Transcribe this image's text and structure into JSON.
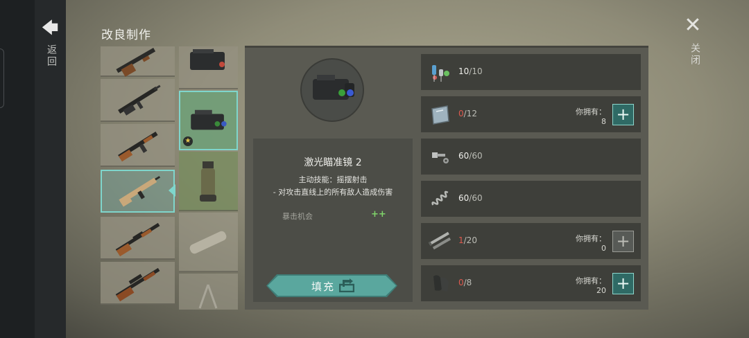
{
  "header": {
    "title": "改良制作"
  },
  "nav": {
    "back_label": "返回",
    "close_label": "关闭"
  },
  "item": {
    "name": "激光瞄准镜 2",
    "skill": "主动技能：摇摆射击",
    "skill_desc": "- 对攻击直线上的所有敌人造成伤害",
    "stat_label": "暴击机会",
    "stat_value": "++"
  },
  "fill_button": {
    "label": "填充"
  },
  "materials": [
    {
      "icon": "electronics-parts-icon",
      "have": "10",
      "need": "/10",
      "have_color": "white"
    },
    {
      "icon": "glass-plate-icon",
      "have": "0",
      "need": "/12",
      "have_color": "red",
      "owned_label": "你拥有：",
      "owned": "8",
      "plus": "active"
    },
    {
      "icon": "bolts-icon",
      "have": "60",
      "need": "/60",
      "have_color": "white"
    },
    {
      "icon": "spring-icon",
      "have": "60",
      "need": "/60",
      "have_color": "white"
    },
    {
      "icon": "metal-pipes-icon",
      "have": "1",
      "need": "/20",
      "have_color": "red",
      "owned_label": "你拥有：",
      "owned": "0",
      "plus": "disabled"
    },
    {
      "icon": "rubber-sheet-icon",
      "have": "0",
      "need": "/8",
      "have_color": "red",
      "owned_label": "你拥有：",
      "owned": "20",
      "plus": "active"
    }
  ],
  "weapons": [
    "shotgun-icon",
    "assault-rifle-icon",
    "ak-rifle-icon",
    "scar-rifle-icon",
    "dragunov-rifle-icon",
    "sniper-rifle-icon"
  ],
  "attachments": [
    "laser-sight-icon",
    "laser-sight-2-icon",
    "vertical-grip-icon",
    "silencer-icon",
    "bipod-icon"
  ],
  "colors": {
    "accent": "#7fd6cc",
    "red": "#e05a4f",
    "green": "#7fd46a"
  }
}
